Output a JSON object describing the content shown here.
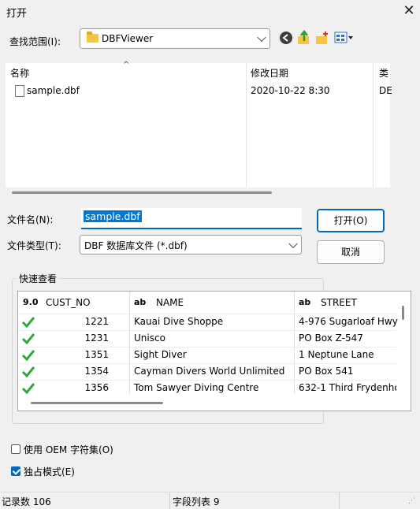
{
  "window": {
    "title": "打开"
  },
  "lookin": {
    "label": "查找范围(I):",
    "value": "DBFViewer"
  },
  "list": {
    "headers": {
      "name": "名称",
      "date": "修改日期",
      "type": "类"
    },
    "files": [
      {
        "name": "sample.dbf",
        "date": "2020-10-22 8:30",
        "type": "DE"
      }
    ]
  },
  "filename": {
    "label": "文件名(N):",
    "value": "sample.dbf"
  },
  "filetype": {
    "label": "文件类型(T):",
    "value": "DBF 数据库文件 (*.dbf)"
  },
  "buttons": {
    "open": "打开(O)",
    "cancel": "取消"
  },
  "preview": {
    "title": "快速查看",
    "columns": [
      {
        "type": "9.0",
        "name": "CUST_NO"
      },
      {
        "type": "ab",
        "name": "NAME"
      },
      {
        "type": "ab",
        "name": "STREET"
      }
    ],
    "rows": [
      {
        "cust_no": "1221",
        "name": "Kauai Dive Shoppe",
        "street": "4-976 Sugarloaf Hwy"
      },
      {
        "cust_no": "1231",
        "name": "Unisco",
        "street": "PO Box Z-547"
      },
      {
        "cust_no": "1351",
        "name": "Sight Diver",
        "street": "1 Neptune Lane"
      },
      {
        "cust_no": "1354",
        "name": "Cayman Divers World Unlimited",
        "street": "PO Box 541"
      },
      {
        "cust_no": "1356",
        "name": "Tom Sawyer Diving Centre",
        "street": "632-1 Third Frydenho"
      }
    ]
  },
  "options": {
    "oem": "使用 OEM 字符集(O)",
    "exclusive": "独占模式(E)"
  },
  "status": {
    "records": "记录数 106",
    "fields": "字段列表 9"
  }
}
